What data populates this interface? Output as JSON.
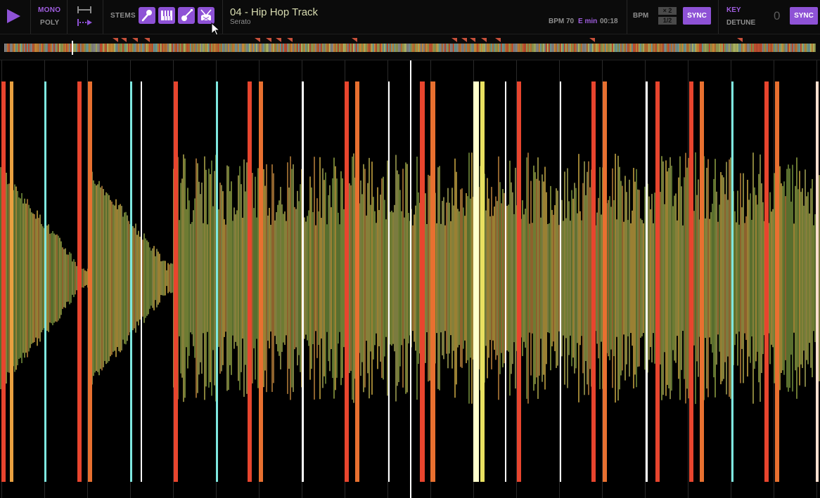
{
  "toolbar": {
    "play_icon": "play-icon",
    "mode_mono": "MONO",
    "mode_poly": "POLY",
    "loop_icons": [
      "loop-bar-icon",
      "loop-arrow-icon"
    ],
    "stems_label": "STEMS",
    "stems": [
      {
        "name": "vocals",
        "icon": "microphone-icon"
      },
      {
        "name": "melody",
        "icon": "piano-icon"
      },
      {
        "name": "bass",
        "icon": "guitar-icon"
      },
      {
        "name": "drums",
        "icon": "drum-icon"
      }
    ],
    "stem_color": "#8e52d6"
  },
  "track": {
    "title": "04 - Hip Hop Track",
    "artist": "Serato",
    "bpm_text": "BPM 70",
    "key_text": "E min",
    "time_text": "00:18"
  },
  "tempo": {
    "bpm_label": "BPM",
    "times_two": "× 2",
    "half": "1/2",
    "sync_label": "SYNC"
  },
  "key": {
    "key_label": "KEY",
    "detune_label": "DETUNE",
    "detune_value": "0",
    "sync_label": "SYNC"
  },
  "colors": {
    "accent": "#8e52d6",
    "key_accent": "#a05ee0",
    "title_text": "#d7dbb0"
  }
}
